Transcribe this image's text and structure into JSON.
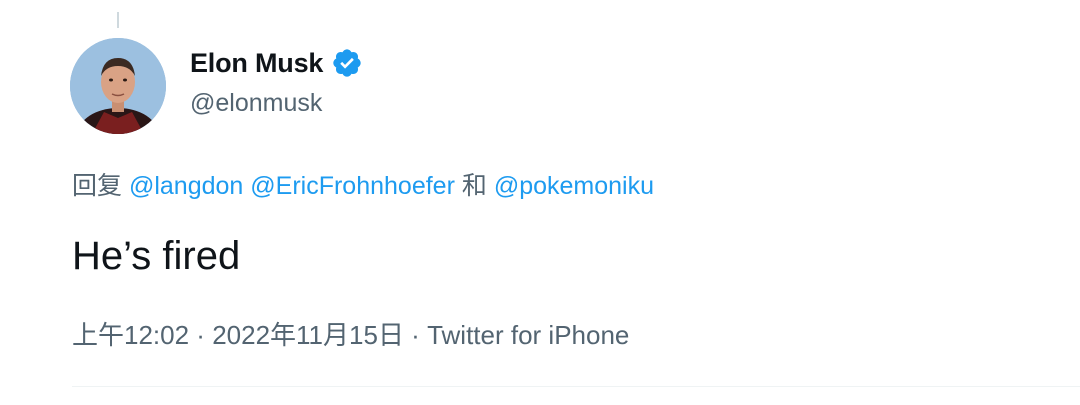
{
  "author": {
    "display_name": "Elon Musk",
    "handle": "@elonmusk",
    "verified": true,
    "verified_icon": "verified-badge-icon",
    "verified_color": "#1d9bf0"
  },
  "reply": {
    "prefix": "回复 ",
    "mentions": [
      "@langdon",
      "@EricFrohnhoefer",
      "@pokemoniku"
    ],
    "connector_space": " ",
    "conjunction": " 和 "
  },
  "tweet": {
    "text": "He’s fired"
  },
  "meta": {
    "time": "上午12:02",
    "separator": " · ",
    "date": "2022年11月15日",
    "source": "Twitter for iPhone"
  },
  "colors": {
    "link": "#1d9bf0",
    "secondary_text": "#536471",
    "primary_text": "#0f1419"
  }
}
